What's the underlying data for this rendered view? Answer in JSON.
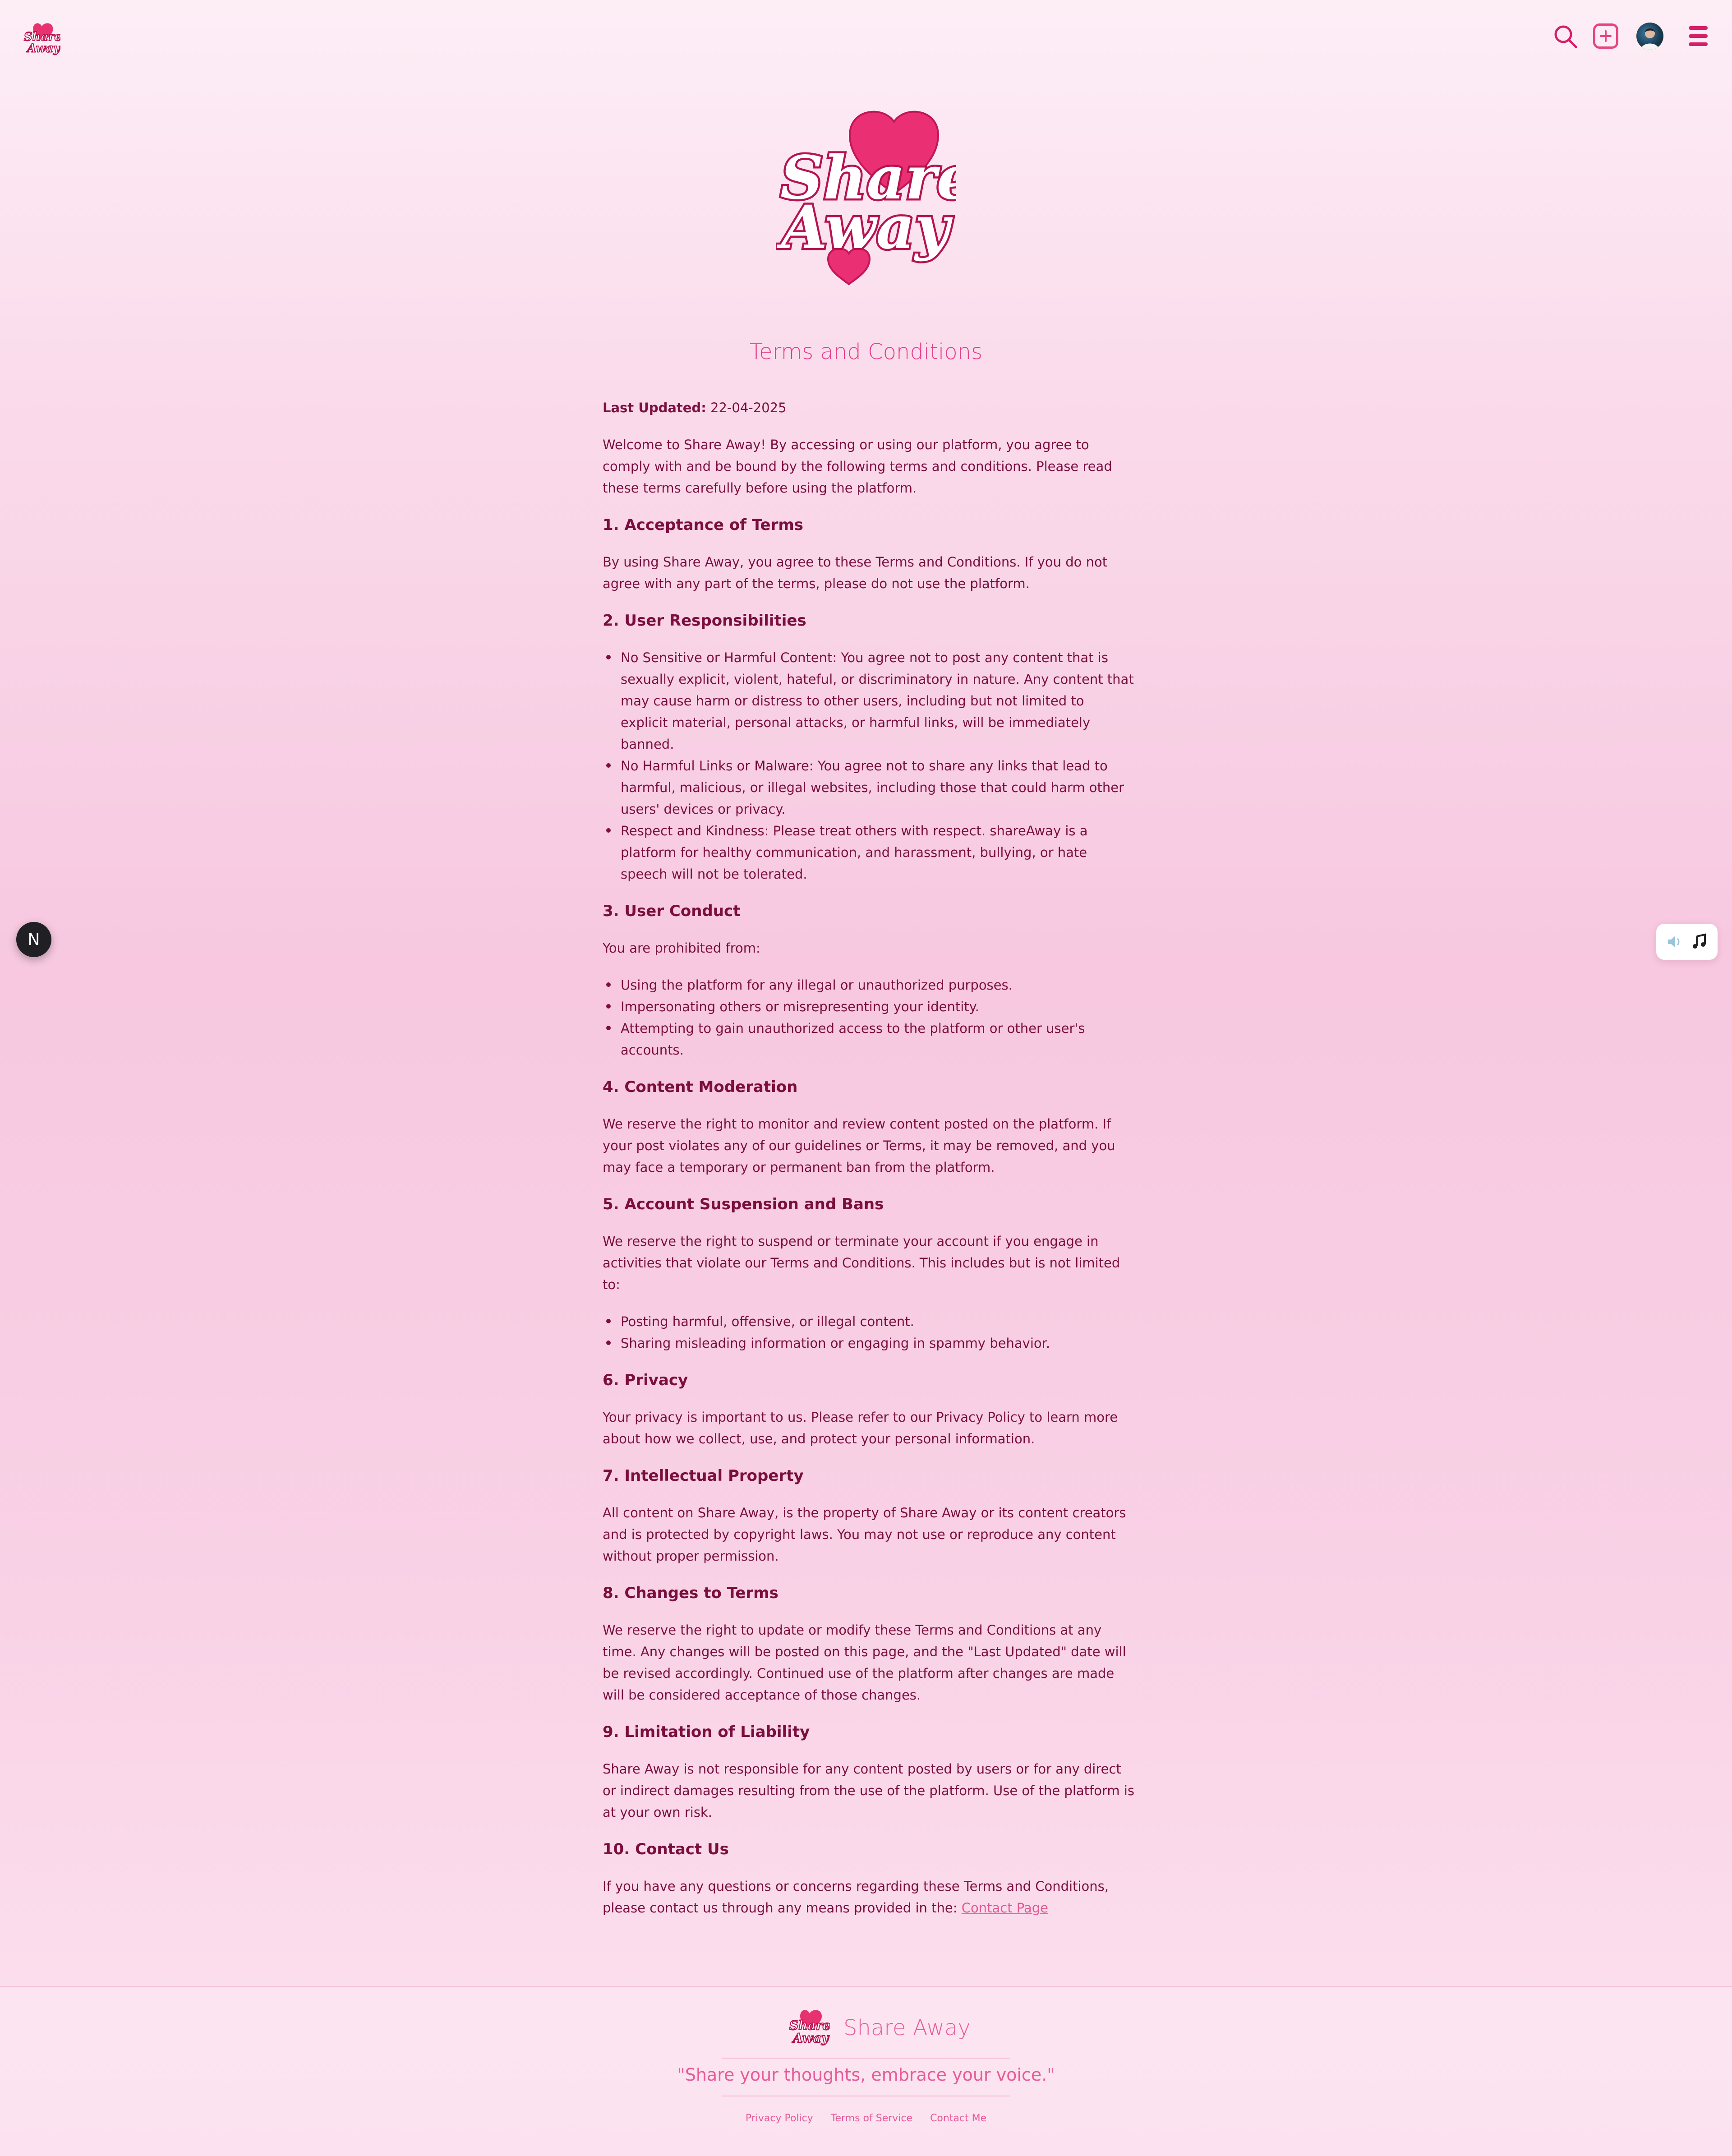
{
  "brand": {
    "name": "Share Away",
    "logo_text_1": "Share",
    "logo_text_2": "Away"
  },
  "colors": {
    "accent": "#e43c8a",
    "text": "#7a1040",
    "background": "#fadbeb"
  },
  "nav": {
    "icons": [
      "search-icon",
      "add-icon",
      "avatar",
      "menu-icon"
    ]
  },
  "page": {
    "title": "Terms and Conditions"
  },
  "terms": {
    "updated_label": "Last Updated:",
    "updated_value": "22-04-2025",
    "intro": "Welcome to Share Away! By accessing or using our platform, you agree to comply with and be bound by the following terms and conditions. Please read these terms carefully before using the platform.",
    "s1_title": "1. Acceptance of Terms",
    "s1_text": "By using Share Away, you agree to these Terms and Conditions. If you do not agree with any part of the terms, please do not use the platform.",
    "s2_title": "2. User Responsibilities",
    "s2_items": [
      "No Sensitive or Harmful Content: You agree not to post any content that is sexually explicit, violent, hateful, or discriminatory in nature. Any content that may cause harm or distress to other users, including but not limited to explicit material, personal attacks, or harmful links, will be immediately banned.",
      "No Harmful Links or Malware: You agree not to share any links that lead to harmful, malicious, or illegal websites, including those that could harm other users' devices or privacy.",
      "Respect and Kindness: Please treat others with respect. shareAway is a platform for healthy communication, and harassment, bullying, or hate speech will not be tolerated."
    ],
    "s3_title": "3. User Conduct",
    "s3_text": "You are prohibited from:",
    "s3_items": [
      "Using the platform for any illegal or unauthorized purposes.",
      "Impersonating others or misrepresenting your identity.",
      "Attempting to gain unauthorized access to the platform or other user's accounts."
    ],
    "s4_title": "4. Content Moderation",
    "s4_text": "We reserve the right to monitor and review content posted on the platform. If your post violates any of our guidelines or Terms, it may be removed, and you may face a temporary or permanent ban from the platform.",
    "s5_title": "5. Account Suspension and Bans",
    "s5_text": "We reserve the right to suspend or terminate your account if you engage in activities that violate our Terms and Conditions. This includes but is not limited to:",
    "s5_items": [
      "Posting harmful, offensive, or illegal content.",
      "Sharing misleading information or engaging in spammy behavior."
    ],
    "s6_title": "6. Privacy",
    "s6_text": "Your privacy is important to us. Please refer to our Privacy Policy to learn more about how we collect, use, and protect your personal information.",
    "s7_title": "7. Intellectual Property",
    "s7_text": "All content on Share Away, is the property of Share Away or its content creators and is protected by copyright laws. You may not use or reproduce any content without proper permission.",
    "s8_title": "8. Changes to Terms",
    "s8_text": "We reserve the right to update or modify these Terms and Conditions at any time. Any changes will be posted on this page, and the \"Last Updated\" date will be revised accordingly. Continued use of the platform after changes are made will be considered acceptance of those changes.",
    "s9_title": "9. Limitation of Liability",
    "s9_text": "Share Away is not responsible for any content posted by users or for any direct or indirect damages resulting from the use of the platform. Use of the platform is at your own risk.",
    "s10_title": "10. Contact Us",
    "s10_text": "If you have any questions or concerns regarding these Terms and Conditions, please contact us through any means provided in the:",
    "s10_link": "Contact Page"
  },
  "badge": {
    "letter": "N"
  },
  "footer": {
    "name": "Share Away",
    "tagline": "\"Share your thoughts, embrace your voice.\"",
    "links": [
      "Privacy Policy",
      "Terms of Service",
      "Contact Me"
    ]
  }
}
